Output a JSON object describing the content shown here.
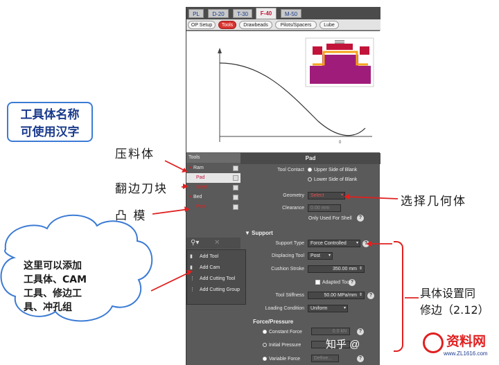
{
  "top_tabs": [
    "PL",
    "D-20",
    "T-30",
    "F-40",
    "M-50"
  ],
  "active_top_tab": "F-40",
  "sub_tabs": [
    "OP Setup",
    "Tools",
    "Drawbeads",
    "Pilots/Spacers",
    "Lube"
  ],
  "active_sub_tab": "Tools",
  "graph": {
    "x_label": "0"
  },
  "tools_panel": {
    "header": "Tools",
    "items": [
      {
        "label": "Ram",
        "indent": false,
        "selected": false,
        "red": false
      },
      {
        "label": "Pad",
        "indent": true,
        "selected": true,
        "red": true
      },
      {
        "label": "Steel",
        "indent": true,
        "selected": false,
        "red": true
      },
      {
        "label": "Bed",
        "indent": false,
        "selected": false,
        "red": false
      },
      {
        "label": "Post",
        "indent": true,
        "selected": false,
        "red": true
      }
    ]
  },
  "tool_menu": {
    "items": [
      "Add Tool",
      "Add Cam",
      "Add Cutting Tool",
      "Add Cutting Group"
    ]
  },
  "pad_panel": {
    "title": "Pad",
    "tool_contact_label": "Tool Contact",
    "tool_contact_options": [
      "Upper Side of Blank",
      "Lower Side of Blank"
    ],
    "geometry_label": "Geometry",
    "geometry_value": "Select",
    "clearance_label": "Clearance",
    "clearance_value": "0.00 mm",
    "only_used_for_shell": "Only Used For Shell",
    "support_section": "Support",
    "support_type_label": "Support Type",
    "support_type_value": "Force Controlled",
    "displacing_tool_label": "Displacing Tool",
    "displacing_tool_value": "Post",
    "cushion_stroke_label": "Cushion Stroke",
    "cushion_stroke_value": "350.00 mm",
    "adapted_tool": "Adapted Tool",
    "tool_stiffness_label": "Tool Stiffness",
    "tool_stiffness_value": "50.00 MPa/mm",
    "loading_condition_label": "Loading Condition",
    "loading_condition_value": "Uniform",
    "force_pressure_section": "Force/Pressure",
    "constant_force": "Constant Force",
    "constant_force_value": "0.0 kN",
    "initial_pressure": "Initial Pressure",
    "variable_force": "Variable Force",
    "variable_force_value": "Define..."
  },
  "annotations": {
    "tool_name_box": [
      "工具体名称",
      "可使用汉字"
    ],
    "pad_label": "压料体",
    "steel_label": "翻边刀块",
    "post_label": "凸 模",
    "geometry_label": "选择几何体",
    "cloud": [
      "这里可以添加",
      "工具体、CAM",
      "工具、修边工",
      "具、冲孔组"
    ],
    "settings_note": [
      "具体设置同",
      "修边（2.12）"
    ]
  },
  "watermark": {
    "zhihu": "知乎 @",
    "site": "资料网",
    "url": "www.ZL1616.com"
  },
  "colors": {
    "arrow": "#e02020",
    "panel": "#5a5a5a",
    "accent_box": "#3b7bd5"
  }
}
